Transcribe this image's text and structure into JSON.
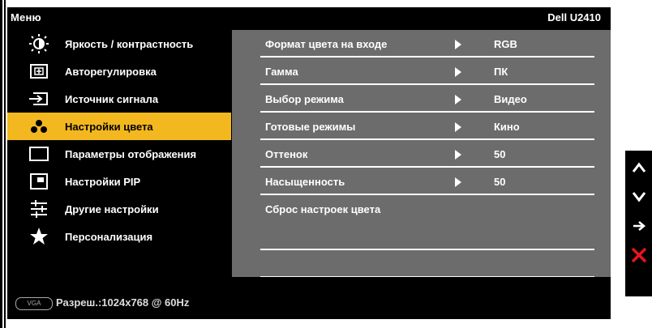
{
  "header": {
    "title": "Меню",
    "model": "Dell U2410"
  },
  "menu": [
    {
      "label": "Яркость / контрастность",
      "icon": "brightness-icon"
    },
    {
      "label": "Авторегулировка",
      "icon": "auto-adjust-icon"
    },
    {
      "label": "Источник сигнала",
      "icon": "input-source-icon"
    },
    {
      "label": "Настройки цвета",
      "icon": "color-settings-icon",
      "active": true
    },
    {
      "label": "Параметры отображения",
      "icon": "display-settings-icon"
    },
    {
      "label": "Настройки PIP",
      "icon": "pip-icon"
    },
    {
      "label": "Другие настройки",
      "icon": "other-settings-icon"
    },
    {
      "label": "Персонализация",
      "icon": "personalize-star-icon"
    }
  ],
  "settings": [
    {
      "label": "Формат цвета на входе",
      "value": "RGB"
    },
    {
      "label": "Гамма",
      "value": "ПК"
    },
    {
      "label": "Выбор режима",
      "value": "Видео"
    },
    {
      "label": "Готовые режимы",
      "value": "Кино"
    },
    {
      "label": "Оттенок",
      "value": "50"
    },
    {
      "label": "Насыщенность",
      "value": "50"
    },
    {
      "label": "Сброс настроек цвета",
      "value": ""
    },
    {
      "label": "",
      "value": ""
    }
  ],
  "footer": {
    "connector": "VGA",
    "resolution": "Разреш.:1024x768 @ 60Hz"
  },
  "side_buttons": [
    "up-arrow-icon",
    "down-arrow-icon",
    "enter-arrow-icon",
    "exit-x-icon"
  ],
  "colors": {
    "accent": "#f3b81f",
    "panel": "#6c6c6c",
    "exit": "#e8141b"
  }
}
